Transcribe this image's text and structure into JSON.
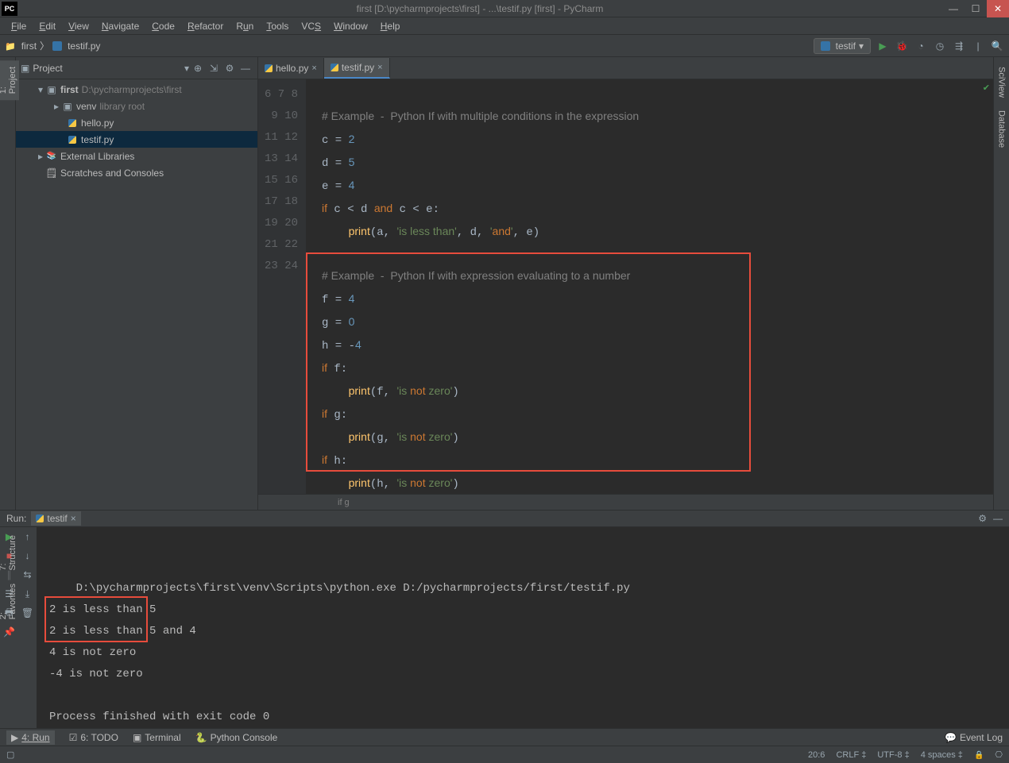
{
  "titlebar": {
    "logo": "PC",
    "title": "first [D:\\pycharmprojects\\first] - ...\\testif.py [first] - PyCharm"
  },
  "menu": [
    "File",
    "Edit",
    "View",
    "Navigate",
    "Code",
    "Refactor",
    "Run",
    "Tools",
    "VCS",
    "Window",
    "Help"
  ],
  "breadcrumb": {
    "folder": "first",
    "file": "testif.py"
  },
  "runconfig": {
    "name": "testif"
  },
  "projectPanel": {
    "title": "Project"
  },
  "tree": {
    "root": {
      "name": "first",
      "path": "D:\\pycharmprojects\\first"
    },
    "venv": {
      "name": "venv",
      "hint": "library root"
    },
    "files": [
      "hello.py",
      "testif.py"
    ],
    "ext": "External Libraries",
    "scratches": "Scratches and Consoles"
  },
  "tabs": [
    {
      "name": "hello.py",
      "active": false
    },
    {
      "name": "testif.py",
      "active": true
    }
  ],
  "editor": {
    "startLine": 6,
    "lines": [
      "",
      "# Example  -  Python If with multiple conditions in the expression",
      "c = 2",
      "d = 5",
      "e = 4",
      "if c < d and c < e:",
      "    print(a, 'is less than', d, 'and', e)",
      "",
      "# Example  -  Python If with expression evaluating to a number",
      "f = 4",
      "g = 0",
      "h = -4",
      "if f:",
      "    print(f, 'is not zero')",
      "if g:",
      "    print(g, 'is not zero')",
      "if h:",
      "    print(h, 'is not zero')",
      ""
    ],
    "currentLine": 20,
    "breadcrumb": "if g"
  },
  "run": {
    "label": "Run:",
    "tabName": "testif",
    "lines": [
      "D:\\pycharmprojects\\first\\venv\\Scripts\\python.exe D:/pycharmprojects/first/testif.py",
      "2 is less than 5",
      "2 is less than 5 and 4",
      "4 is not zero",
      "-4 is not zero",
      "",
      "Process finished with exit code 0"
    ]
  },
  "toolWindows": {
    "run": "4: Run",
    "todo": "6: TODO",
    "terminal": "Terminal",
    "pyconsole": "Python Console",
    "eventlog": "Event Log"
  },
  "leftTabs": {
    "project": "1: Project",
    "structure": "7: Structure",
    "favorites": "2: Favorites"
  },
  "rightTabs": {
    "sciview": "SciView",
    "database": "Database"
  },
  "status": {
    "pos": "20:6",
    "lineSep": "CRLF",
    "encoding": "UTF-8",
    "indent": "4 spaces"
  }
}
